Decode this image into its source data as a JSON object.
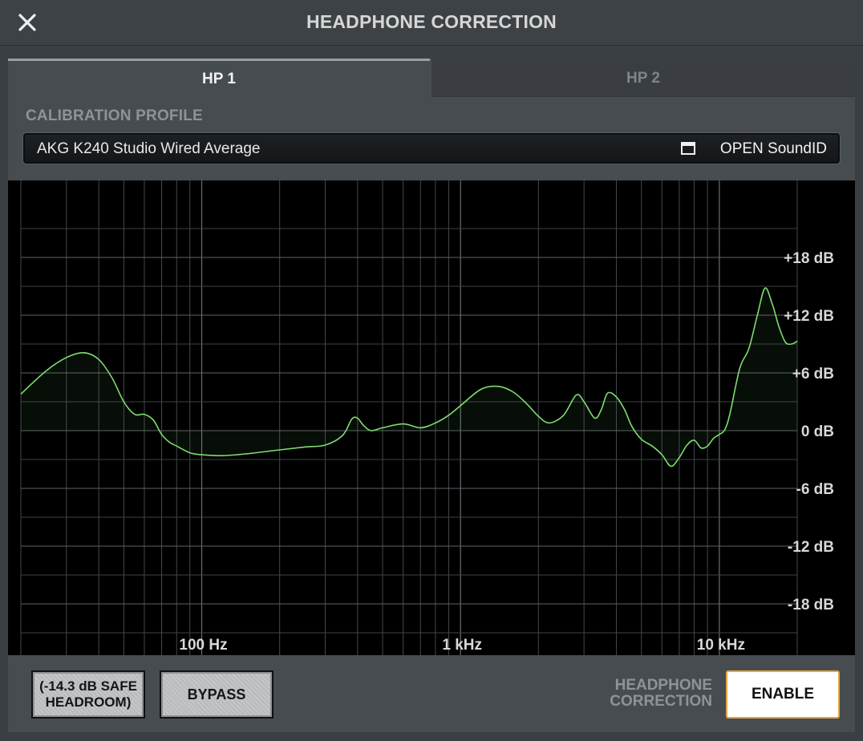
{
  "window": {
    "title": "HEADPHONE CORRECTION"
  },
  "tabs": [
    {
      "label": "HP 1",
      "active": true
    },
    {
      "label": "HP 2",
      "active": false
    }
  ],
  "calibration": {
    "section_label": "CALIBRATION PROFILE",
    "profile_value": "AKG K240 Studio Wired Average",
    "open_label": "OPEN SoundID"
  },
  "chart_data": {
    "type": "line",
    "x_scale": "log",
    "xlim": [
      20,
      20000
    ],
    "ylim": [
      -24,
      24
    ],
    "grid": true,
    "x_tick_labels": [
      "100 Hz",
      "1 kHz",
      "10 kHz"
    ],
    "y_tick_labels": [
      "+18 dB",
      "+12 dB",
      "+6 dB",
      "0 dB",
      "-6 dB",
      "-12 dB",
      "-18 dB"
    ],
    "x_ticks": [
      100,
      1000,
      10000
    ],
    "y_ticks": [
      18,
      12,
      6,
      0,
      -6,
      -12,
      -18
    ],
    "line_color": "#7ddc6f",
    "series": [
      {
        "x": [
          20,
          25,
          30,
          35,
          40,
          45,
          50,
          55,
          60,
          65,
          70,
          75,
          80,
          90,
          100,
          120,
          150,
          200,
          250,
          300,
          350,
          380,
          400,
          420,
          450,
          500,
          600,
          700,
          800,
          900,
          1000,
          1200,
          1400,
          1600,
          1800,
          2000,
          2200,
          2500,
          2800,
          3000,
          3300,
          3500,
          3700,
          4000,
          4300,
          4600,
          5000,
          5500,
          6000,
          6500,
          7000,
          7500,
          8000,
          8500,
          9000,
          9500,
          10000,
          10500,
          11000,
          12000,
          13000,
          14000,
          15000,
          16000,
          17000,
          18000,
          19000,
          20000
        ],
        "y": [
          3.8,
          6.2,
          7.6,
          8.1,
          7.4,
          5.5,
          3.0,
          1.7,
          1.7,
          1.1,
          -0.4,
          -1.2,
          -1.6,
          -2.3,
          -2.5,
          -2.6,
          -2.4,
          -2.0,
          -1.7,
          -1.5,
          -0.5,
          1.2,
          1.3,
          0.6,
          0.0,
          0.3,
          0.7,
          0.3,
          0.8,
          1.6,
          2.6,
          4.3,
          4.6,
          4.0,
          2.8,
          1.5,
          0.8,
          1.6,
          3.7,
          3.0,
          1.3,
          2.2,
          3.9,
          3.5,
          2.2,
          0.4,
          -0.9,
          -1.6,
          -2.5,
          -3.7,
          -2.8,
          -1.5,
          -1.0,
          -1.8,
          -1.6,
          -0.8,
          -0.4,
          0.1,
          1.8,
          6.5,
          8.5,
          11.9,
          14.8,
          13.2,
          10.8,
          9.2,
          9.0,
          9.3
        ]
      }
    ]
  },
  "bottom": {
    "headroom_label": "(-14.3 dB SAFE HEADROOM)",
    "bypass_label": "BYPASS",
    "correction_label": "HEADPHONE CORRECTION",
    "enable_label": "ENABLE"
  }
}
